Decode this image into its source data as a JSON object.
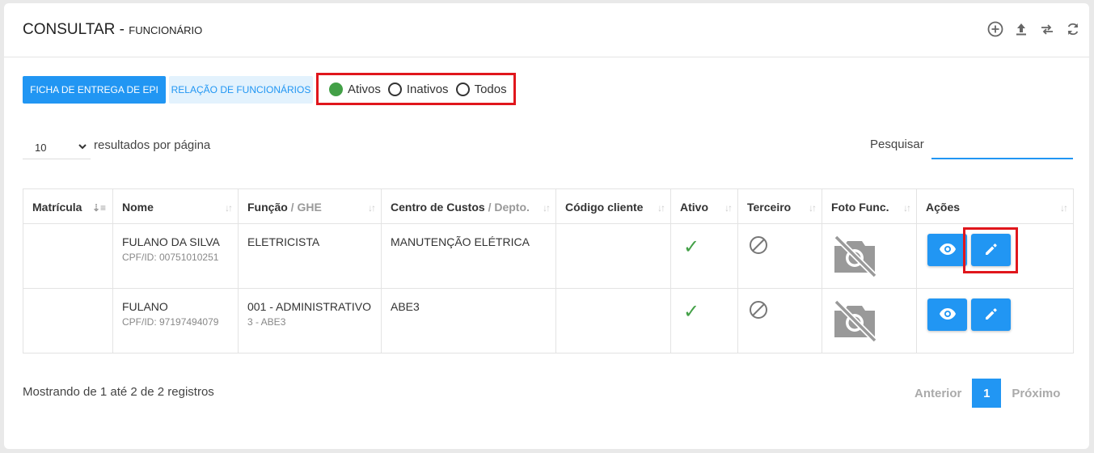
{
  "header": {
    "title": "CONSULTAR",
    "separator": " - ",
    "subtitle": "FUNCIONÁRIO",
    "icons": [
      "add-circle-icon",
      "upload-icon",
      "swap-icon",
      "refresh-icon"
    ]
  },
  "toolbar": {
    "ficha_label": "FICHA DE ENTREGA DE EPI",
    "relacao_label": "RELAÇÃO DE FUNCIONÁRIOS",
    "radios": [
      {
        "label": "Ativos",
        "selected": true
      },
      {
        "label": "Inativos",
        "selected": false
      },
      {
        "label": "Todos",
        "selected": false
      }
    ]
  },
  "controls": {
    "page_size": "10",
    "per_page_label": "resultados por página",
    "search_label": "Pesquisar",
    "search_value": ""
  },
  "table": {
    "columns": [
      {
        "label": "Matrícula",
        "muted": ""
      },
      {
        "label": "Nome",
        "muted": ""
      },
      {
        "label": "Função",
        "muted": " / GHE"
      },
      {
        "label": "Centro de Custos",
        "muted": " / Depto."
      },
      {
        "label": "Código cliente",
        "muted": ""
      },
      {
        "label": "Ativo",
        "muted": ""
      },
      {
        "label": "Terceiro",
        "muted": ""
      },
      {
        "label": "Foto Func.",
        "muted": ""
      },
      {
        "label": "Ações",
        "muted": ""
      }
    ],
    "rows": [
      {
        "matricula": "",
        "nome": "FULANO DA SILVA",
        "cpf": "CPF/ID: 00751010251",
        "funcao": "ELETRICISTA",
        "ghe": "",
        "centro": "MANUTENÇÃO ELÉTRICA",
        "codigo": "",
        "ativo": "✓",
        "edit_highlighted": true
      },
      {
        "matricula": "",
        "nome": "FULANO",
        "cpf": "CPF/ID: 97197494079",
        "funcao": "001 - ADMINISTRATIVO",
        "ghe": "3 - ABE3",
        "centro": "ABE3",
        "codigo": "",
        "ativo": "✓",
        "edit_highlighted": false
      }
    ]
  },
  "footer": {
    "info": "Mostrando de 1 até 2 de 2 registros",
    "prev": "Anterior",
    "current_page": "1",
    "next": "Próximo"
  },
  "colors": {
    "primary": "#2196f3",
    "success": "#43a047",
    "highlight": "#e0161c"
  }
}
